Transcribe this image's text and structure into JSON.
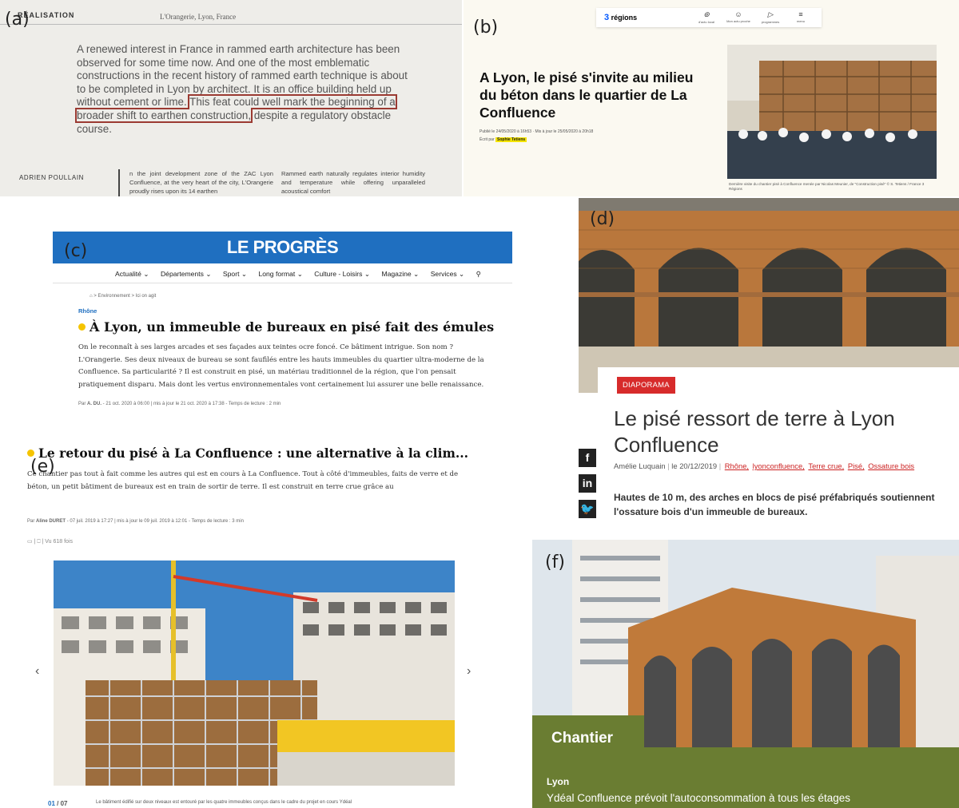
{
  "panels": {
    "a": {
      "label": "(a)",
      "running_head": "RÉALISATION",
      "running_head_2": "L'Orangerie, Lyon, France",
      "lead_text": "A renewed interest in France in rammed earth architecture has been observed for some time now. And one of the most emblematic constructions in the recent history of rammed earth technique is about to be completed in Lyon by architect",
      "lead_it_is": ". It is an office building held up without cement or lime.",
      "highlighted": "This feat could well mark the beginning of a broader shift to earthen construction,",
      "lead_end": " despite a regulatory obstacle course.",
      "author": "ADRIEN POULLAIN",
      "column_1": "n the joint development zone of the ZAC Lyon Confluence, at the very heart of the city, L'Orangerie proudly rises upon its 14 earthen",
      "column_2": "Rammed earth naturally regulates interior humidity and temperature while offering unparalleled acoustical comfort"
    },
    "b": {
      "label": "(b)",
      "logo_prefix": "3",
      "logo_text": "régions",
      "nav_icons": [
        {
          "glyph": "⊚",
          "label": "d'actu local"
        },
        {
          "glyph": "☺",
          "label": "Mon actu proche"
        },
        {
          "glyph": "▷",
          "label": "programmes"
        },
        {
          "glyph": "≡",
          "label": "menu"
        }
      ],
      "title": "A Lyon, le pisé s'invite au milieu du béton dans le quartier de La Confluence",
      "meta_published": "Publié le 24/05/2020 à 16h53 · Mis à jour le 25/05/2020 à 20h18",
      "meta_by_prefix": "Écrit par",
      "meta_author": "Sophie Tetiens",
      "caption": "Dernière visite du chantier pisé à Confluence menée par Nicolas Meunier, de \"Construction pisé\" © S. Tetiens / France 3 Régions"
    },
    "c": {
      "label": "(c)",
      "brand": "LE PROGRÈS",
      "menu": [
        "Actualité ⌄",
        "Départements ⌄",
        "Sport ⌄",
        "Long format ⌄",
        "Culture - Loisirs ⌄",
        "Magazine ⌄",
        "Services ⌄",
        "⚲"
      ],
      "breadcrumb": "⌂ > Environnement > Ici on agit",
      "kicker": "Rhône",
      "title": "À Lyon, un immeuble de bureaux en pisé fait des émules",
      "body": "On le reconnaît à ses larges arcades et ses façades aux teintes ocre foncé. Ce bâtiment intrigue. Son nom ? L'Orangerie. Ses deux niveaux de bureau se sont faufilés entre les hauts immeubles du quartier ultra-moderne de la Confluence. Sa particularité ? Il est construit en pisé, un matériau traditionnel de la région, que l'on pensait pratiquement disparu. Mais dont les vertus environnementales vont certainement lui assurer une belle renaissance.",
      "byline_prefix": "Par",
      "byline_author": "A. DU.",
      "byline_rest": " - 21 oct. 2020 à 06:00 | mis à jour le 21 oct. 2020 à 17:38 - Temps de lecture : 2 min"
    },
    "d": {
      "label": "(d)",
      "badge": "DIAPORAMA",
      "title": "Le pisé ressort de terre à Lyon Confluence",
      "author": "Amélie Luquain",
      "date": "le 20/12/2019",
      "tags": [
        "Rhône,",
        "lyonconfluence,",
        "Terre crue,",
        "Pisé,",
        "Ossature bois"
      ],
      "lead": "Hautes de 10 m, des arches en blocs de pisé préfabriqués soutiennent l'ossature bois d'un immeuble de bureaux.",
      "social": [
        "f",
        "in",
        "🐦"
      ]
    },
    "e": {
      "label": "(e)",
      "title": "Le retour du pisé à La Confluence : une alternative à la clim...",
      "body": "Ce chantier pas tout à fait comme les autres qui est en cours à La Confluence. Tout à côté d'immeubles, faits de verre et de béton, un petit bâtiment de bureaux est en train de sortir de terre. Il est construit en terre crue grâce au",
      "byline_prefix": "Par",
      "byline_author": "Aline DURET",
      "byline_rest": " - 07 juil. 2019 à 17:27 | mis à jour le 09 juil. 2019 à 12:01 - Temps de lecture : 3 min",
      "tools": "▭ | ⎕ | Vu 618 fois",
      "prev": "‹",
      "next": "›",
      "counter_current": "01",
      "counter_total": " / 07",
      "caption": "Le bâtiment édifié sur deux niveaux est entouré par les quatre immeubles conçus dans le cadre du projet en cours Ydéal"
    },
    "f": {
      "label": "(f)",
      "section": "Chantier",
      "city": "Lyon",
      "headline": "Ydéal Confluence prévoit l'autoconsommation à tous les étages"
    }
  },
  "colors": {
    "progres_blue": "#1f6fc0",
    "diaporama_red": "#d72b2b",
    "highlight_box": "#9b3a32",
    "chantier_green": "#6a7d32",
    "rammed_earth": "#b9773c"
  }
}
